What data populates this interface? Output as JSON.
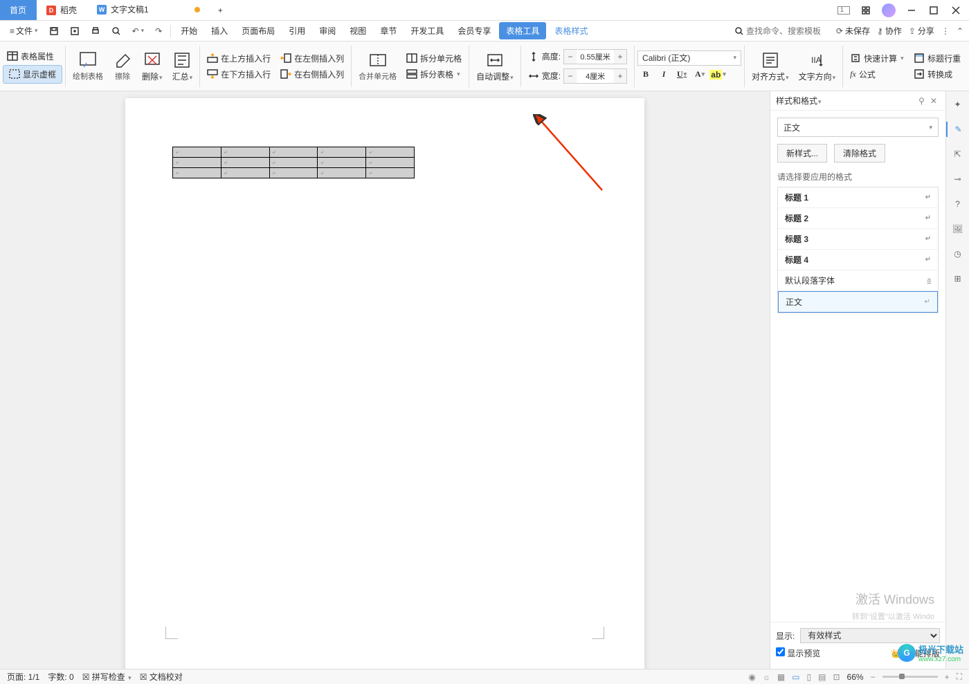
{
  "tabs": {
    "home": "首页",
    "docker": "稻壳",
    "doc": "文字文稿1",
    "add": "+"
  },
  "window": {
    "one": "1"
  },
  "menu": {
    "file": "文件",
    "start": "开始",
    "insert": "插入",
    "layout": "页面布局",
    "ref": "引用",
    "review": "审阅",
    "view": "视图",
    "chapter": "章节",
    "dev": "开发工具",
    "member": "会员专享",
    "tableTools": "表格工具",
    "tableStyle": "表格样式"
  },
  "menuRight": {
    "searchPh": "查找命令、搜索模板",
    "unsaved": "未保存",
    "coop": "协作",
    "share": "分享"
  },
  "ribbon": {
    "tableProps": "表格属性",
    "showVirt": "显示虚框",
    "drawTable": "绘制表格",
    "erase": "擦除",
    "delete": "删除",
    "summary": "汇总",
    "insTop": "在上方插入行",
    "insBot": "在下方插入行",
    "insLeft": "在左侧插入列",
    "insRight": "在右侧插入列",
    "merge": "合并单元格",
    "splitCell": "拆分单元格",
    "splitTable": "拆分表格",
    "autoFit": "自动调整",
    "height": "高度:",
    "heightVal": "0.55厘米",
    "width": "宽度:",
    "widthVal": "4厘米",
    "font": "Calibri (正文)",
    "align": "对齐方式",
    "textDir": "文字方向",
    "fastCalc": "快速计算",
    "titleRow": "标题行重",
    "formula": "公式",
    "convert": "转换成"
  },
  "panel": {
    "title": "样式和格式",
    "current": "正文",
    "newStyle": "新样式...",
    "clearFmt": "清除格式",
    "chooseLabel": "请选择要应用的格式",
    "styles": [
      "标题 1",
      "标题 2",
      "标题 3",
      "标题 4",
      "默认段落字体",
      "正文"
    ],
    "showLabel": "显示:",
    "showVal": "有效样式",
    "previewChk": "显示预览",
    "smart": "智能排版"
  },
  "status": {
    "page": "页面: 1/1",
    "words": "字数: 0",
    "spell": "拼写检查",
    "proofread": "文档校对",
    "zoom": "66%"
  },
  "watermark": {
    "l1": "激活 Windows",
    "l2": "转到\"设置\"以激活 Windo"
  },
  "logo": {
    "t1": "极光下载站",
    "t2": "www.xz7.com"
  }
}
